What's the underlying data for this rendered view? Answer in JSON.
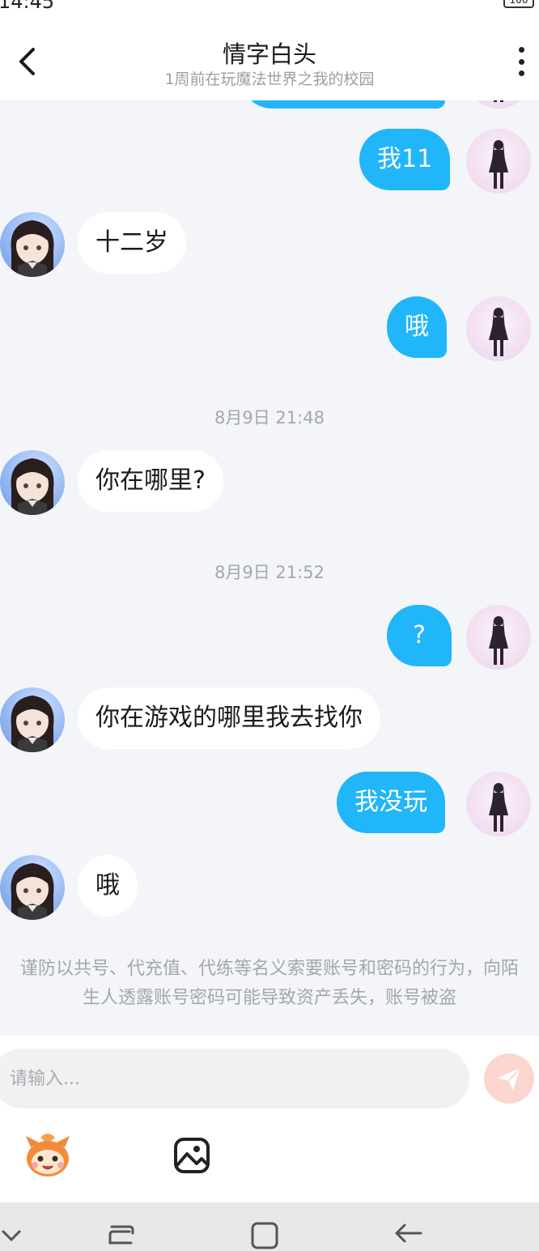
{
  "status_bar": {
    "time": "14:45",
    "battery": "100"
  },
  "header": {
    "title": "情字白头",
    "subtitle": "1周前在玩魔法世界之我的校园"
  },
  "messages": [
    {
      "side": "out",
      "text": "我11"
    },
    {
      "side": "in",
      "text": "十二岁"
    },
    {
      "side": "out",
      "text": "哦"
    },
    {
      "type": "time",
      "text": "8月9日 21:48"
    },
    {
      "side": "in",
      "text": "你在哪里?"
    },
    {
      "type": "time",
      "text": "8月9日 21:52"
    },
    {
      "side": "out",
      "text": "?"
    },
    {
      "side": "in",
      "text": "你在游戏的哪里我去找你"
    },
    {
      "side": "out",
      "text": "我没玩"
    },
    {
      "side": "in",
      "text": "哦"
    }
  ],
  "notice": "谨防以共号、代充值、代练等名义索要账号和密码的行为，向陌生人透露账号密码可能导致资产丢失，账号被盗",
  "input": {
    "placeholder": "请输入..."
  },
  "colors": {
    "outgoing_bubble": "#20b6f9",
    "incoming_bubble": "#ffffff",
    "send_button": "#fbd6ce"
  },
  "icons": [
    "back-arrow-icon",
    "more-vertical-icon",
    "send-icon",
    "emoji-icon",
    "image-icon",
    "nav-down-icon",
    "nav-recent-icon",
    "nav-home-icon",
    "nav-back-icon"
  ]
}
